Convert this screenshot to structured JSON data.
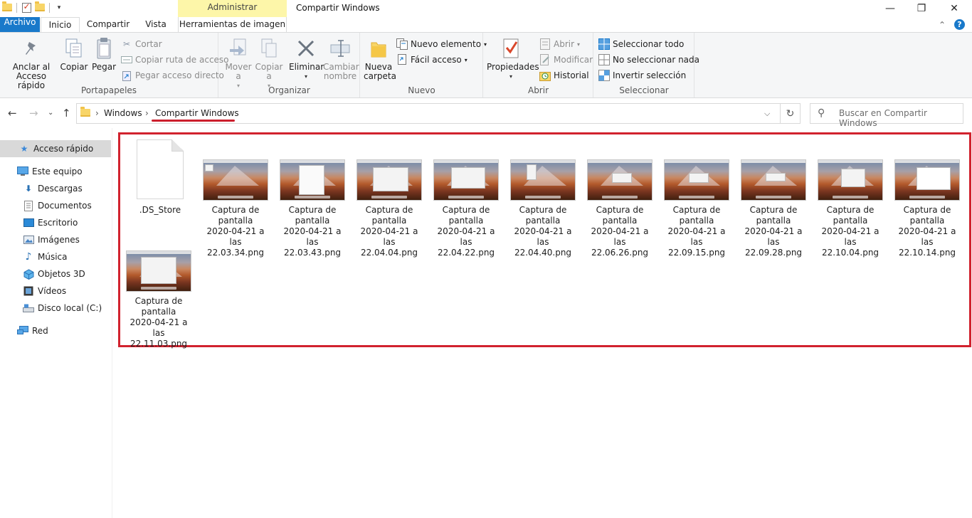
{
  "window": {
    "title": "Compartir Windows",
    "context_tab_header": "Administrar",
    "minimize": "—",
    "maximize": "❐",
    "close": "✕"
  },
  "tabs": {
    "file": "Archivo",
    "home": "Inicio",
    "share": "Compartir",
    "view": "Vista",
    "picture_tools": "Herramientas de imagen",
    "collapse": "⌃",
    "help": "?"
  },
  "ribbon": {
    "clipboard": {
      "label": "Portapapeles",
      "pin": "Anclar al Acceso rápido",
      "copy": "Copiar",
      "paste": "Pegar",
      "cut": "Cortar",
      "copy_path": "Copiar ruta de acceso",
      "paste_shortcut": "Pegar acceso directo"
    },
    "organize": {
      "label": "Organizar",
      "move_to": "Mover a",
      "copy_to": "Copiar a",
      "delete": "Eliminar",
      "rename": "Cambiar nombre"
    },
    "new": {
      "label": "Nuevo",
      "new_folder": "Nueva carpeta",
      "new_item": "Nuevo elemento",
      "easy_access": "Fácil acceso"
    },
    "open": {
      "label": "Abrir",
      "properties": "Propiedades",
      "open": "Abrir",
      "edit": "Modificar",
      "history": "Historial"
    },
    "select": {
      "label": "Seleccionar",
      "select_all": "Seleccionar todo",
      "select_none": "No seleccionar nada",
      "invert": "Invertir selección"
    }
  },
  "address": {
    "crumbs": [
      "Windows",
      "Compartir Windows"
    ],
    "search_placeholder": "Buscar en Compartir Windows"
  },
  "nav": [
    {
      "label": "Acceso rápido",
      "icon": "star-icon"
    },
    {
      "label": "Este equipo",
      "icon": "computer-icon"
    },
    {
      "label": "Descargas",
      "icon": "download-icon"
    },
    {
      "label": "Documentos",
      "icon": "document-icon"
    },
    {
      "label": "Escritorio",
      "icon": "desktop-icon"
    },
    {
      "label": "Imágenes",
      "icon": "pictures-icon"
    },
    {
      "label": "Música",
      "icon": "music-icon"
    },
    {
      "label": "Objetos 3D",
      "icon": "3d-objects-icon"
    },
    {
      "label": "Vídeos",
      "icon": "video-icon"
    },
    {
      "label": "Disco local (C:)",
      "icon": "drive-icon"
    },
    {
      "label": "Red",
      "icon": "network-icon"
    }
  ],
  "files": [
    {
      "l1": ".DS_Store",
      "l2": "",
      "l3": "",
      "l4": ""
    },
    {
      "l1": "Captura de",
      "l2": "pantalla",
      "l3": "2020-04-21 a las",
      "l4": "22.03.34.png"
    },
    {
      "l1": "Captura de",
      "l2": "pantalla",
      "l3": "2020-04-21 a las",
      "l4": "22.03.43.png"
    },
    {
      "l1": "Captura de",
      "l2": "pantalla",
      "l3": "2020-04-21 a las",
      "l4": "22.04.04.png"
    },
    {
      "l1": "Captura de",
      "l2": "pantalla",
      "l3": "2020-04-21 a las",
      "l4": "22.04.22.png"
    },
    {
      "l1": "Captura de",
      "l2": "pantalla",
      "l3": "2020-04-21 a las",
      "l4": "22.04.40.png"
    },
    {
      "l1": "Captura de",
      "l2": "pantalla",
      "l3": "2020-04-21 a las",
      "l4": "22.06.26.png"
    },
    {
      "l1": "Captura de",
      "l2": "pantalla",
      "l3": "2020-04-21 a las",
      "l4": "22.09.15.png"
    },
    {
      "l1": "Captura de",
      "l2": "pantalla",
      "l3": "2020-04-21 a las",
      "l4": "22.09.28.png"
    },
    {
      "l1": "Captura de",
      "l2": "pantalla",
      "l3": "2020-04-21 a las",
      "l4": "22.10.04.png"
    },
    {
      "l1": "Captura de",
      "l2": "pantalla",
      "l3": "2020-04-21 a las",
      "l4": "22.10.14.png"
    },
    {
      "l1": "Captura de",
      "l2": "pantalla",
      "l3": "2020-04-21 a las",
      "l4": "22.11.03.png"
    }
  ],
  "colors": {
    "accent": "#1979ca",
    "highlight_box": "#d1222e",
    "context_tab": "#fdf6a9"
  }
}
